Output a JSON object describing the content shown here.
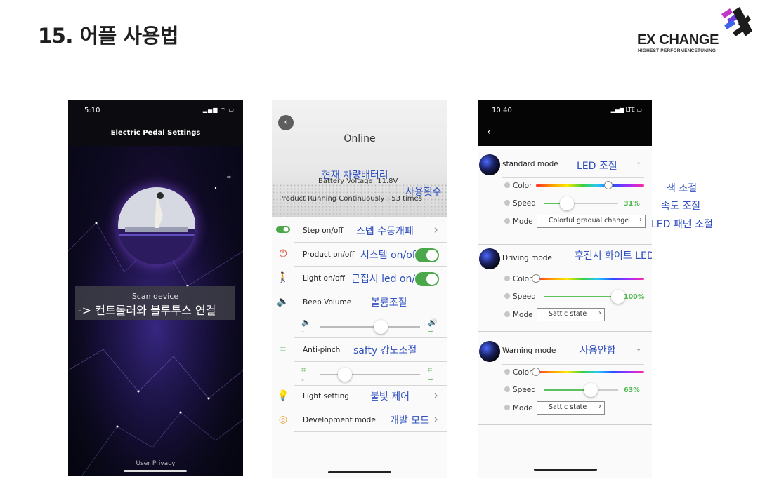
{
  "slide": {
    "title": "15. 어플 사용법"
  },
  "logo": {
    "text": "EX CHANGE",
    "subtitle": "HIGHEST PERFORMENCETUNING"
  },
  "phone1": {
    "time": "5:10",
    "title": "Electric Pedal Settings",
    "scan_label": "Scan device",
    "scan_annotation": "-> 컨트롤러와 블루투스 연결",
    "privacy_link": "User Privacy"
  },
  "phone2": {
    "status": "Online",
    "battery_annotation": "현재 차량배터리",
    "battery_voltage": "Battery Voltage: 11.8V",
    "running_annotation": "사용횟수",
    "running_text": "Product Running Continuously : 53  times",
    "rows": [
      {
        "label": "Step on/off",
        "annotation": "스텝 수동개폐"
      },
      {
        "label": "Product on/off",
        "annotation": "시스템 on/off"
      },
      {
        "label": "Light on/off",
        "annotation": "근접시 led on/off"
      },
      {
        "label": "Beep Volume",
        "annotation": "볼륨조절"
      },
      {
        "label": "Anti-pinch",
        "annotation": "safty 강도조절"
      },
      {
        "label": "Light setting",
        "annotation": "불빛 제어"
      },
      {
        "label": "Development mode",
        "annotation": "개발 모드"
      }
    ],
    "beep_volume_level": 0.61,
    "anti_pinch_level": 0.25,
    "slider_min_symbol": "-",
    "slider_max_symbol": "+"
  },
  "phone3": {
    "time": "10:40",
    "network": "LTE",
    "labels": {
      "color": "Color",
      "speed": "Speed",
      "mode": "Mode"
    },
    "modes": [
      {
        "name": "standard mode",
        "annotation": "LED 조절",
        "color_pos": 0.67,
        "speed_pct": 31,
        "speed_text": "31%",
        "mode_value": "Colorful gradual change"
      },
      {
        "name": "Driving mode",
        "annotation": "후진시 화이트 LED조절",
        "color_pos": 0.0,
        "speed_pct": 100,
        "speed_text": "100%",
        "mode_value": "Sattic state"
      },
      {
        "name": "Warning mode",
        "annotation": "사용안함",
        "color_pos": 0.0,
        "speed_pct": 63,
        "speed_text": "63%",
        "mode_value": "Sattic state"
      }
    ],
    "side_annotations": {
      "color": "색 조절",
      "speed": "속도 조절",
      "pattern": "LED 패턴 조절"
    }
  },
  "colors": {
    "annotation": "#2f4fc0",
    "toggle_on": "#4aa84a",
    "speed_fill": "#5cc05c"
  }
}
